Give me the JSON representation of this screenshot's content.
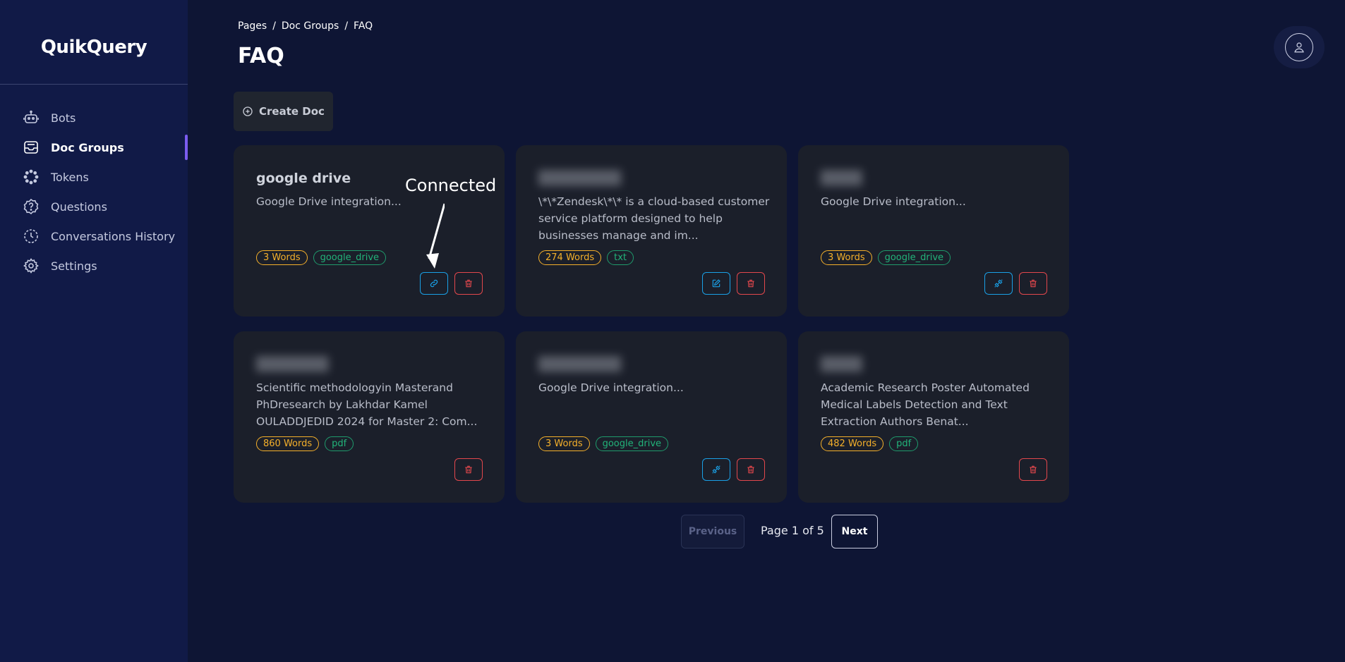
{
  "app": {
    "brand": "QuikQuery"
  },
  "sidebar": {
    "items": [
      {
        "label": "Bots",
        "icon": "robot-icon"
      },
      {
        "label": "Doc Groups",
        "icon": "inbox-icon",
        "active": true
      },
      {
        "label": "Tokens",
        "icon": "tokens-icon"
      },
      {
        "label": "Questions",
        "icon": "question-icon"
      },
      {
        "label": "Conversations History",
        "icon": "history-icon"
      },
      {
        "label": "Settings",
        "icon": "gear-icon"
      }
    ]
  },
  "breadcrumb": {
    "items": [
      "Pages",
      "Doc Groups",
      "FAQ"
    ],
    "separator": "/"
  },
  "page": {
    "title": "FAQ"
  },
  "toolbar": {
    "create_label": "Create Doc"
  },
  "annotation": {
    "text": "Connected"
  },
  "cards": [
    {
      "title": "google drive",
      "desc": "Google Drive integration...",
      "words": "3 Words",
      "type": "google_drive",
      "actions": [
        "link-icon",
        "trash-icon"
      ]
    },
    {
      "title": "",
      "desc": "\\*\\*Zendesk\\*\\* is a cloud-based customer service platform designed to help businesses manage and im...",
      "words": "274 Words",
      "type": "txt",
      "actions": [
        "edit-icon",
        "trash-icon"
      ]
    },
    {
      "title": "",
      "desc": "Google Drive integration...",
      "words": "3 Words",
      "type": "google_drive",
      "actions": [
        "unlink-icon",
        "trash-icon"
      ]
    },
    {
      "title": "",
      "desc": "Scientific methodologyin Masterand PhDresearch by Lakhdar Kamel OULADDJEDID 2024 for Master 2: Com...",
      "words": "860 Words",
      "type": "pdf",
      "actions": [
        "trash-icon"
      ]
    },
    {
      "title": "",
      "desc": "Google Drive integration...",
      "words": "3 Words",
      "type": "google_drive",
      "actions": [
        "unlink-icon",
        "trash-icon"
      ]
    },
    {
      "title": "",
      "desc": "Academic Research Poster Automated Medical Labels Detection and Text Extraction Authors Benat...",
      "words": "482 Words",
      "type": "pdf",
      "actions": [
        "trash-icon"
      ]
    }
  ],
  "pagination": {
    "previous": "Previous",
    "label": "Page 1 of 5",
    "next": "Next"
  },
  "colors": {
    "accent": "#7b5cf0",
    "words_tag": "#f5b02a",
    "type_tag": "#22b37a",
    "blue_action": "#1aa0e6",
    "red_action": "#e3474c"
  }
}
